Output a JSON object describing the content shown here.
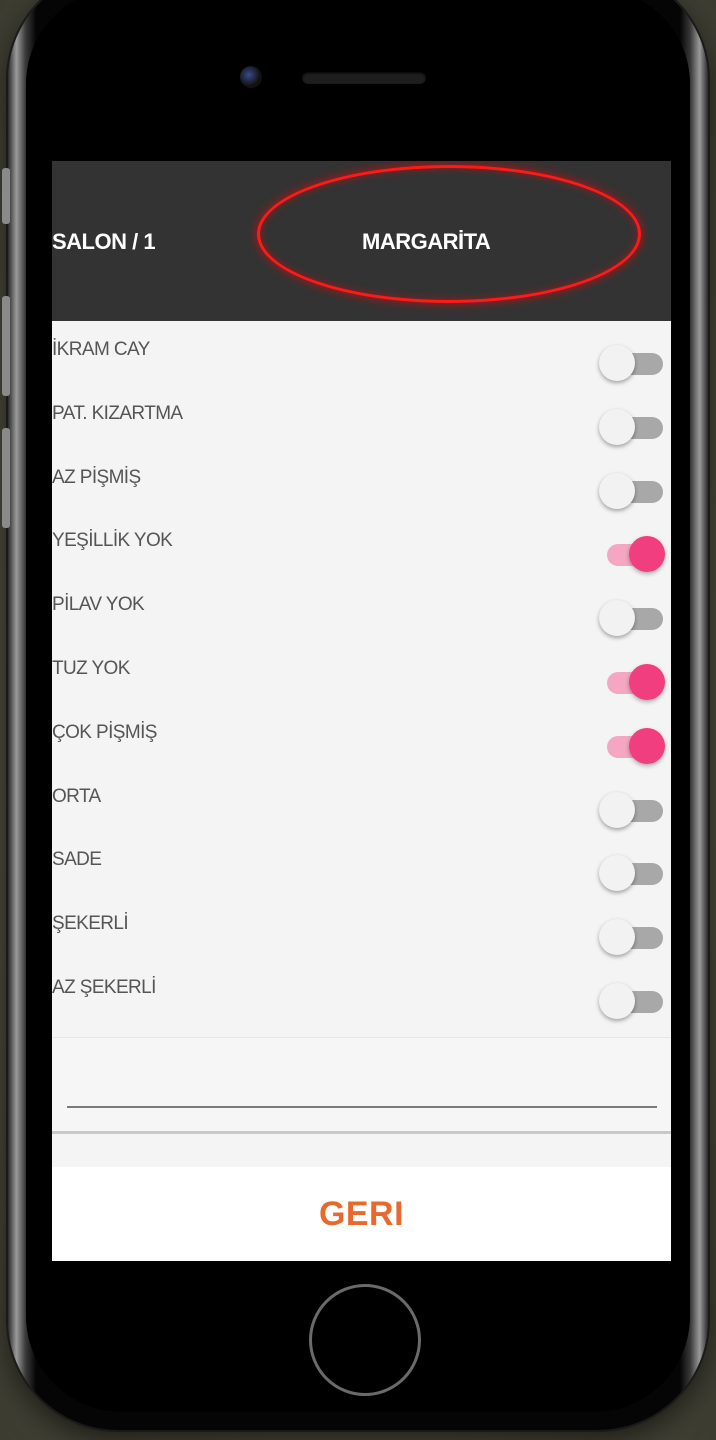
{
  "header": {
    "table": "SALON / 1",
    "product": "MARGARİTA"
  },
  "options": [
    {
      "label": "İKRAM CAY",
      "on": false
    },
    {
      "label": "PAT. KIZARTMA",
      "on": false
    },
    {
      "label": "AZ PİŞMİŞ",
      "on": false
    },
    {
      "label": "YEŞİLLİK YOK",
      "on": true
    },
    {
      "label": "PİLAV YOK",
      "on": false
    },
    {
      "label": "TUZ YOK",
      "on": true
    },
    {
      "label": "ÇOK PİŞMİŞ",
      "on": true
    },
    {
      "label": "ORTA",
      "on": false
    },
    {
      "label": "SADE",
      "on": false
    },
    {
      "label": "ŞEKERLİ",
      "on": false
    },
    {
      "label": "AZ ŞEKERLİ",
      "on": false
    }
  ],
  "note": {
    "value": ""
  },
  "footer": {
    "back_label": "GERI"
  },
  "colors": {
    "header_bg": "#333333",
    "toggle_on": "#f03e7f",
    "toggle_off": "#a8a8a8",
    "accent": "#e8692e",
    "highlight": "#ff1a1a"
  }
}
